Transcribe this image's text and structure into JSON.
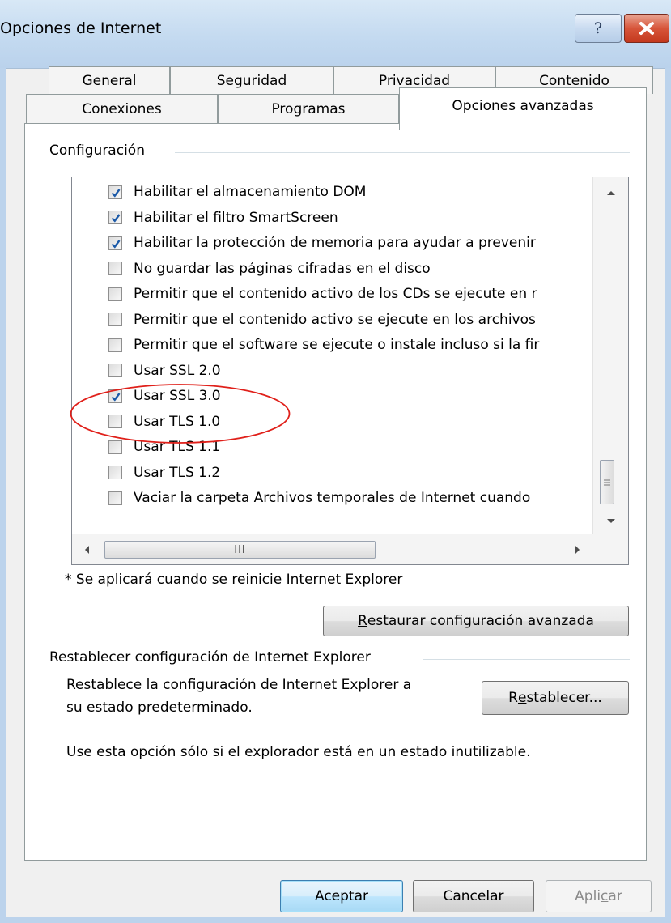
{
  "window": {
    "title": "Opciones de Internet",
    "help_glyph": "?",
    "close_icon": "close-icon"
  },
  "tabs": {
    "row1": [
      "General",
      "Seguridad",
      "Privacidad",
      "Contenido"
    ],
    "row2": [
      "Conexiones",
      "Programas",
      "Opciones avanzadas"
    ],
    "active": "Opciones avanzadas"
  },
  "config": {
    "group_label": "Configuración",
    "items": [
      {
        "label": "Habilitar el almacenamiento DOM",
        "checked": true
      },
      {
        "label": "Habilitar el filtro SmartScreen",
        "checked": true
      },
      {
        "label": "Habilitar la protección de memoria para ayudar a prevenir",
        "checked": true
      },
      {
        "label": "No guardar las páginas cifradas en el disco",
        "checked": false
      },
      {
        "label": "Permitir que el contenido activo de los CDs se ejecute en r",
        "checked": false
      },
      {
        "label": "Permitir que el contenido activo se ejecute en los archivos",
        "checked": false
      },
      {
        "label": "Permitir que el software se ejecute o instale incluso si la fir",
        "checked": false
      },
      {
        "label": "Usar SSL 2.0",
        "checked": false
      },
      {
        "label": "Usar SSL 3.0",
        "checked": true
      },
      {
        "label": "Usar TLS 1.0",
        "checked": false
      },
      {
        "label": "Usar TLS 1.1",
        "checked": false
      },
      {
        "label": "Usar TLS 1.2",
        "checked": false
      },
      {
        "label": "Vaciar la carpeta Archivos temporales de Internet cuando",
        "checked": false
      }
    ],
    "hscroll_grip": "III",
    "note": "* Se aplicará cuando se reinicie Internet Explorer",
    "restore_button": {
      "accel": "R",
      "rest": "estaurar configuración avanzada"
    }
  },
  "reset": {
    "group_label": "Restablecer configuración de Internet Explorer",
    "description_line1": "Restablece la configuración de Internet Explorer a",
    "description_line2": "su estado predeterminado.",
    "button": {
      "pre": "R",
      "accel": "e",
      "rest": "stablecer..."
    },
    "warning": "Use esta opción sólo si el explorador está en un estado inutilizable."
  },
  "footer": {
    "ok": "Aceptar",
    "cancel": "Cancelar",
    "apply": {
      "pre": "Apli",
      "accel": "c",
      "rest": "ar"
    }
  },
  "colors": {
    "highlight_ellipse": "#e0201a",
    "check": "#1c5aa8"
  }
}
